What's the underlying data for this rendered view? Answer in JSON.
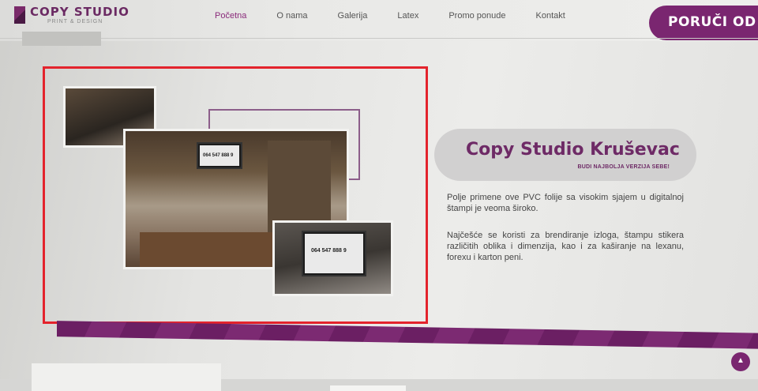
{
  "header": {
    "logo_title": "COPY STUDIO",
    "logo_subtitle": "PRINT & DESIGN",
    "nav": [
      "Početna",
      "O nama",
      "Galerija",
      "Latex",
      "Promo ponude",
      "Kontakt"
    ],
    "active_nav": "Početna",
    "order_button": "PORUČI OD"
  },
  "gallery": {
    "tv_label_1": "064 547 888 9",
    "tv_label_2": "064 547 888 9"
  },
  "banner": {
    "title": "Copy Studio Kruševac",
    "subtitle": "BUDI NAJBOLJA VERZIJA SEBE!"
  },
  "content": {
    "paragraph_1": "Polje primene ove PVC folije sa visokim sjajem u digitalnoj štampi je veoma široko.",
    "paragraph_2": "Najčešće se koristi za brendiranje izloga, štampu stikera različitih oblika i dimenzija, kao i za kaširanje na lexanu, forexu i karton peni."
  },
  "colors": {
    "brand_purple": "#7a2670",
    "highlight_red": "#e3232c"
  },
  "icons": {
    "scroll_top": "chevron-up-icon"
  }
}
